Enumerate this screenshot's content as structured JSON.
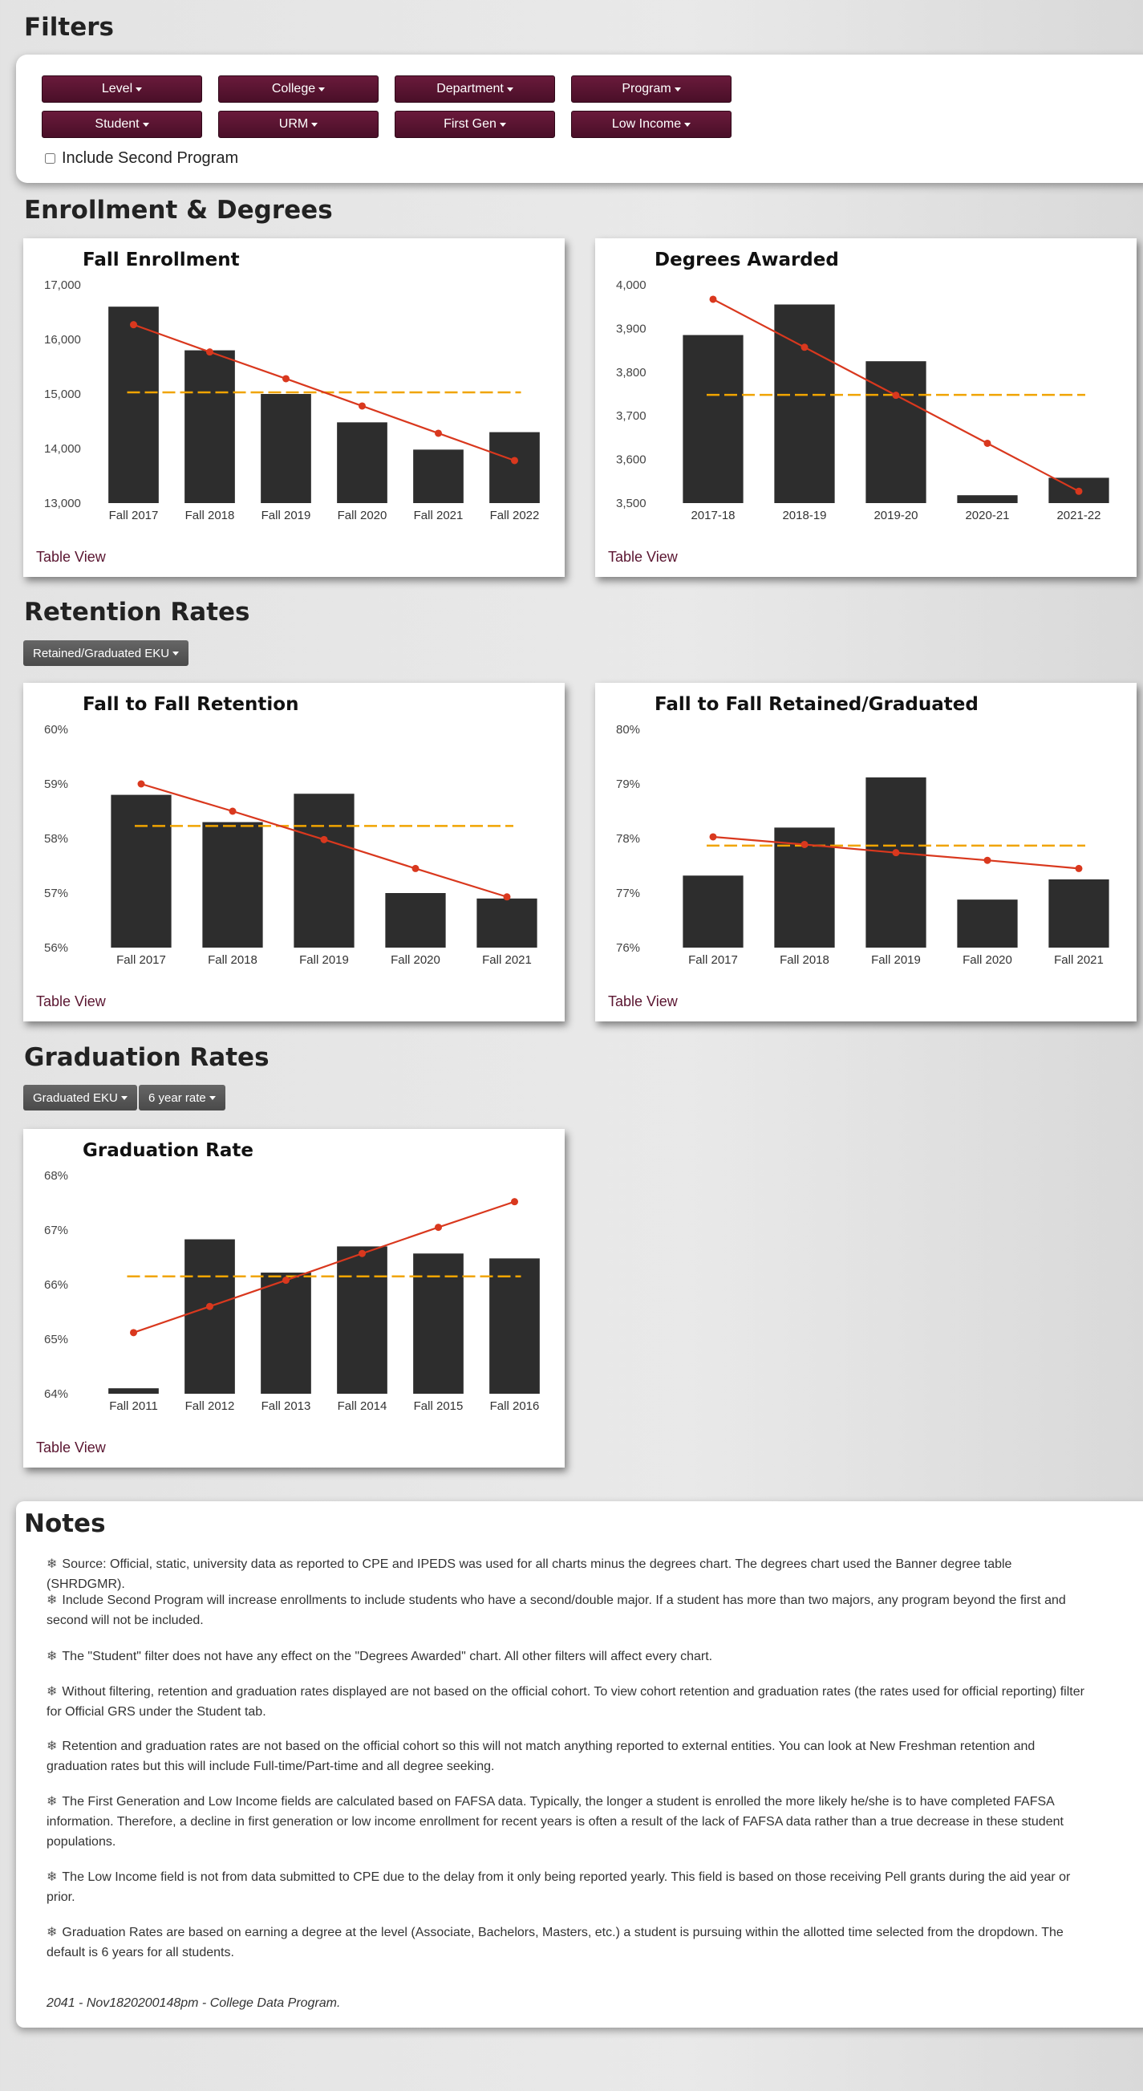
{
  "filters": {
    "heading": "Filters",
    "buttons": [
      "Level",
      "College",
      "Department",
      "Program",
      "Student",
      "URM",
      "First Gen",
      "Low Income"
    ],
    "include_second_program": "Include Second Program"
  },
  "sections": {
    "enrollment": "Enrollment & Degrees",
    "retention": "Retention Rates",
    "graduation": "Graduation Rates"
  },
  "dropdowns": {
    "retention": "Retained/Graduated EKU",
    "graduation_type": "Graduated EKU",
    "graduation_rate": "6 year rate"
  },
  "table_view": "Table View",
  "colors": {
    "bar": "#2d2d2d",
    "trend": "#d9381e",
    "average": "#f0a400",
    "accent": "#5a1530"
  },
  "chart_data": [
    {
      "type": "bar",
      "title": "Fall Enrollment",
      "categories": [
        "Fall 2017",
        "Fall 2018",
        "Fall 2019",
        "Fall 2020",
        "Fall 2021",
        "Fall 2022"
      ],
      "values": [
        16600,
        15800,
        15000,
        14480,
        13980,
        14300
      ],
      "trend": [
        16270,
        15770,
        15280,
        14780,
        14280,
        13780
      ],
      "average": 15030,
      "ylim": [
        13000,
        17000
      ],
      "yticks": [
        "13,000",
        "14,000",
        "15,000",
        "16,000",
        "17,000"
      ]
    },
    {
      "type": "bar",
      "title": "Degrees Awarded",
      "categories": [
        "2017-18",
        "2018-19",
        "2019-20",
        "2020-21",
        "2021-22"
      ],
      "values": [
        3885,
        3955,
        3825,
        3518,
        3558
      ],
      "trend": [
        3967,
        3857,
        3747,
        3637,
        3527
      ],
      "average": 3748,
      "ylim": [
        3500,
        4000
      ],
      "yticks": [
        "3,500",
        "3,600",
        "3,700",
        "3,800",
        "3,900",
        "4,000"
      ]
    },
    {
      "type": "bar",
      "title": "Fall to Fall Retention",
      "categories": [
        "Fall 2017",
        "Fall 2018",
        "Fall 2019",
        "Fall 2020",
        "Fall 2021"
      ],
      "values": [
        58.8,
        58.3,
        58.82,
        57.0,
        56.9
      ],
      "trend": [
        59.0,
        58.5,
        57.98,
        57.45,
        56.93
      ],
      "average": 58.23,
      "ylim": [
        56,
        60
      ],
      "yticks": [
        "56%",
        "57%",
        "58%",
        "59%",
        "60%"
      ]
    },
    {
      "type": "bar",
      "title": "Fall to Fall Retained/Graduated",
      "categories": [
        "Fall 2017",
        "Fall 2018",
        "Fall 2019",
        "Fall 2020",
        "Fall 2021"
      ],
      "values": [
        77.32,
        78.2,
        79.12,
        76.88,
        77.25
      ],
      "trend": [
        78.03,
        77.89,
        77.74,
        77.6,
        77.45
      ],
      "average": 77.87,
      "ylim": [
        76,
        80
      ],
      "yticks": [
        "76%",
        "77%",
        "78%",
        "79%",
        "80%"
      ]
    },
    {
      "type": "bar",
      "title": "Graduation Rate",
      "categories": [
        "Fall 2011",
        "Fall 2012",
        "Fall 2013",
        "Fall 2014",
        "Fall 2015",
        "Fall 2016"
      ],
      "values": [
        64.1,
        66.83,
        66.22,
        66.7,
        66.57,
        66.48
      ],
      "trend": [
        65.12,
        65.6,
        66.08,
        66.57,
        67.05,
        67.52
      ],
      "average": 66.15,
      "ylim": [
        64,
        68
      ],
      "yticks": [
        "64%",
        "65%",
        "66%",
        "67%",
        "68%"
      ]
    }
  ],
  "notes": {
    "heading": "Notes",
    "items": [
      "Source: Official, static, university data as reported to CPE and IPEDS was used for all charts minus the degrees chart. The degrees chart used the Banner degree table (SHRDGMR).",
      "Include Second Program will increase enrollments to include students who have a second/double major. If a student has more than two majors, any program beyond the first and second will not be included.",
      "The \"Student\" filter does not have any effect on the \"Degrees Awarded\" chart. All other filters will affect every chart.",
      "Without filtering, retention and graduation rates displayed are not based on the official cohort. To view cohort retention and graduation rates (the rates used for official reporting) filter for Official GRS under the Student tab.",
      "Retention and graduation rates are not based on the official cohort so this will not match anything reported to external entities. You can look at New Freshman retention and graduation rates but this will include Full-time/Part-time and all degree seeking.",
      "The First Generation and Low Income fields are calculated based on FAFSA data. Typically, the longer a student is enrolled the more likely he/she is to have completed FAFSA information. Therefore, a decline in first generation or low income enrollment for recent years is often a result of the lack of FAFSA data rather than a true decrease in these student populations.",
      "The Low Income field is not from data submitted to CPE due to the delay from it only being reported yearly. This field is based on those receiving Pell grants during the aid year or prior.",
      "Graduation Rates are based on earning a degree at the level (Associate, Bachelors, Masters, etc.) a student is pursuing within the allotted time selected from the dropdown. The default is 6 years for all students."
    ],
    "footer": "2041 - Nov1820200148pm - College Data Program."
  }
}
